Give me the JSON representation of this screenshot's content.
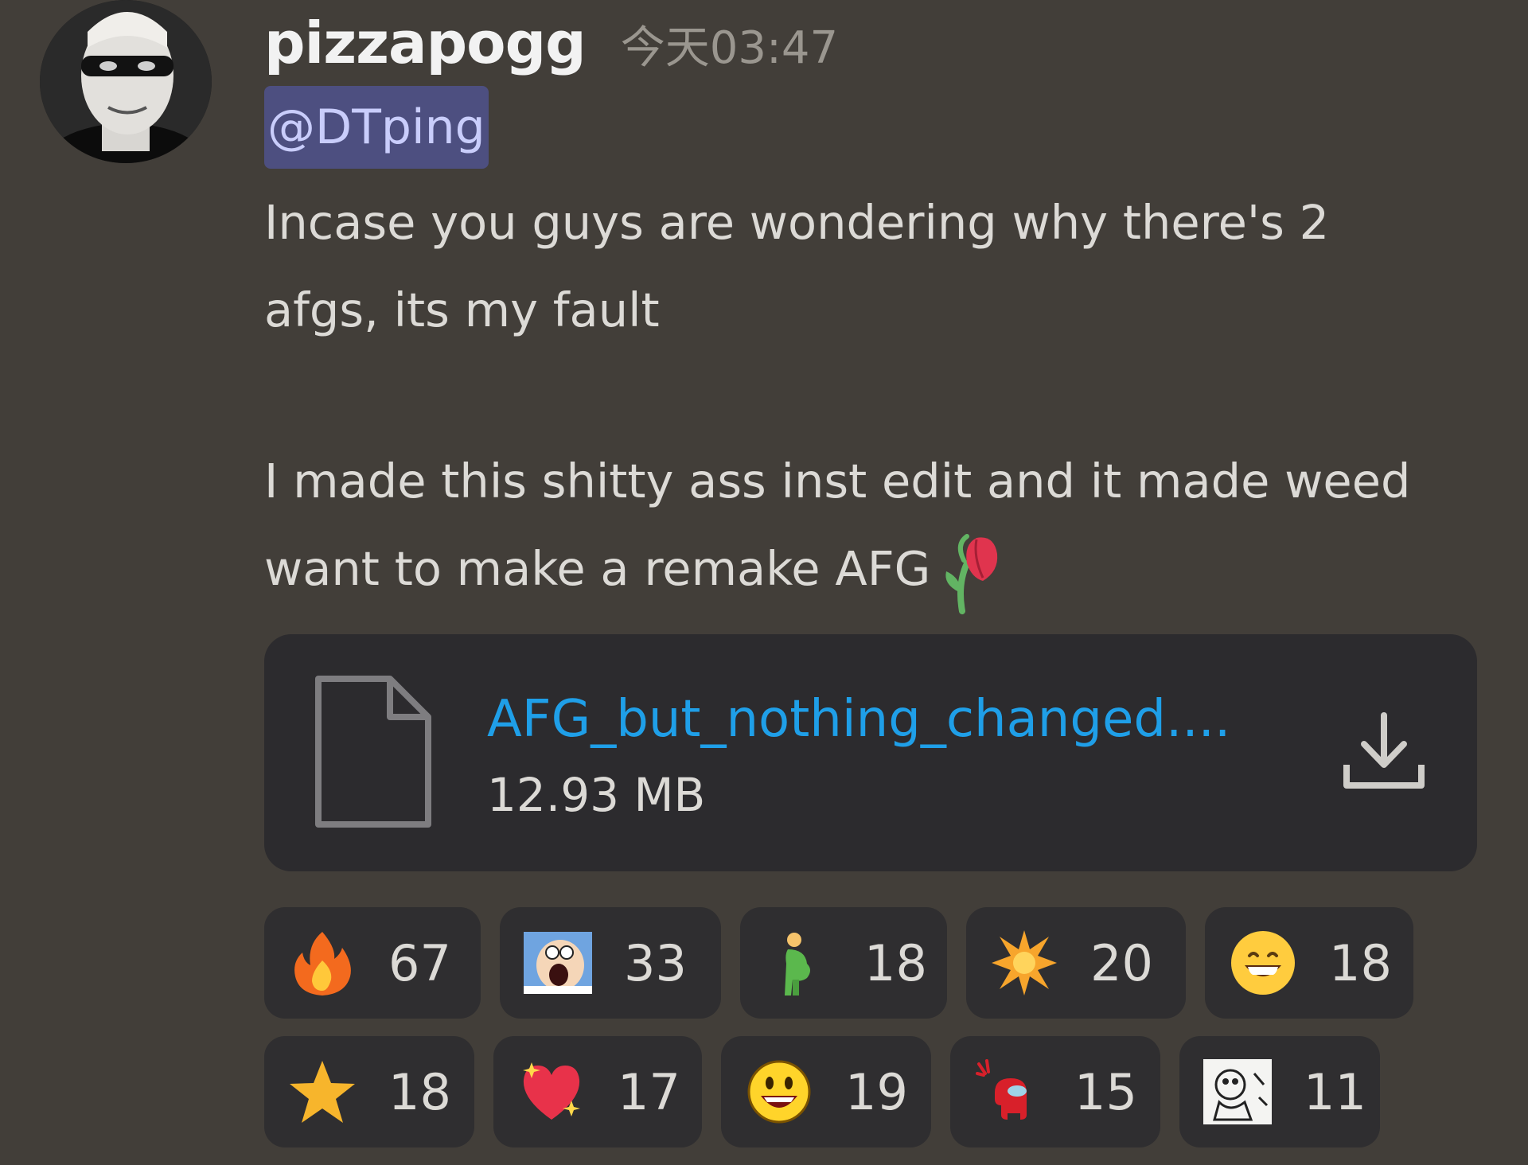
{
  "message": {
    "username": "pizzapogg",
    "timestamp": "今天03:47",
    "mention": "@DTping",
    "paragraph1": "Incase you guys are wondering why there's 2 afgs, its my fault",
    "paragraph2": "I made this shitty ass inst edit and it made weed want to make a remake AFG",
    "paragraph2_emoji": "wilted-rose-icon"
  },
  "attachment": {
    "file_name": "AFG_but_nothing_changed....",
    "file_size": "12.93 MB",
    "file_icon": "file-icon",
    "download_icon": "download-icon"
  },
  "reactions": {
    "row1": [
      {
        "emoji": "fire",
        "count": "67"
      },
      {
        "emoji": "peter-griffin-scream",
        "count": "33"
      },
      {
        "emoji": "pregnant-man",
        "count": "18"
      },
      {
        "emoji": "sparkle-burst",
        "count": "20"
      },
      {
        "emoji": "grinning-face",
        "count": "18"
      }
    ],
    "row2": [
      {
        "emoji": "star",
        "count": "18"
      },
      {
        "emoji": "sparkling-heart",
        "count": "17"
      },
      {
        "emoji": "smiley-face",
        "count": "19"
      },
      {
        "emoji": "among-us-crewmate",
        "count": "15"
      },
      {
        "emoji": "cartoon-sketch",
        "count": "11"
      }
    ]
  },
  "colors": {
    "background": "#423e39",
    "mention_bg": "#4d4f80",
    "link": "#1f9fe8",
    "card_bg": "#2c2b2e",
    "pill_bg": "#2f2e30"
  }
}
